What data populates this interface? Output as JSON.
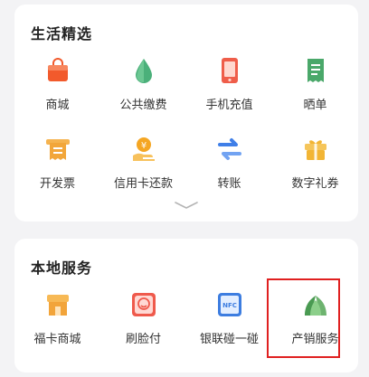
{
  "life": {
    "title": "生活精选",
    "items": [
      {
        "label": "商城",
        "icon": "shopping-bag-icon",
        "color": "#f25a2c"
      },
      {
        "label": "公共缴费",
        "icon": "water-drop-icon",
        "color": "#4bb07a"
      },
      {
        "label": "手机充值",
        "icon": "mobile-phone-icon",
        "color": "#ef5d4a"
      },
      {
        "label": "晒单",
        "icon": "receipt-icon",
        "color": "#4aa86a"
      },
      {
        "label": "开发票",
        "icon": "invoice-icon",
        "color": "#f2a63a"
      },
      {
        "label": "信用卡还款",
        "icon": "hand-coin-icon",
        "color": "#f5a623"
      },
      {
        "label": "转账",
        "icon": "transfer-arrows-icon",
        "color": "#3f7fe8"
      },
      {
        "label": "数字礼券",
        "icon": "gift-icon",
        "color": "#f2b535"
      }
    ],
    "expand_icon": "chevron-down-icon"
  },
  "local": {
    "title": "本地服务",
    "items": [
      {
        "label": "福卡商城",
        "icon": "storefront-icon",
        "color": "#f2a43a"
      },
      {
        "label": "刷脸付",
        "icon": "face-scan-icon",
        "color": "#ef5a4c"
      },
      {
        "label": "银联碰一碰",
        "icon": "nfc-card-icon",
        "color": "#3d7de0"
      },
      {
        "label": "产销服务",
        "icon": "leaf-field-icon",
        "color": "#4a9a52"
      }
    ],
    "nfc_text": "NFC"
  },
  "accent": {
    "highlight": "#e02020"
  }
}
